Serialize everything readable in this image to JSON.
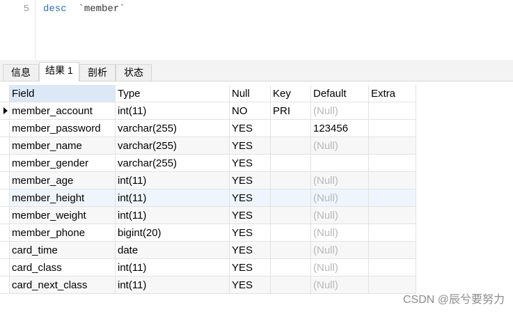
{
  "editor": {
    "line_number": "5",
    "keyword": "desc",
    "identifier": "`member`"
  },
  "tabs": [
    {
      "label": "信息",
      "active": false
    },
    {
      "label": "结果 1",
      "active": true
    },
    {
      "label": "剖析",
      "active": false
    },
    {
      "label": "状态",
      "active": false
    }
  ],
  "table": {
    "columns": [
      "Field",
      "Type",
      "Null",
      "Key",
      "Default",
      "Extra"
    ],
    "rows": [
      {
        "field": "member_account",
        "type": "int(11)",
        "null": "NO",
        "key": "PRI",
        "default": "(Null)",
        "extra": ""
      },
      {
        "field": "member_password",
        "type": "varchar(255)",
        "null": "YES",
        "key": "",
        "default": "123456",
        "extra": ""
      },
      {
        "field": "member_name",
        "type": "varchar(255)",
        "null": "YES",
        "key": "",
        "default": "(Null)",
        "extra": ""
      },
      {
        "field": "member_gender",
        "type": "varchar(255)",
        "null": "YES",
        "key": "",
        "default": "",
        "extra": ""
      },
      {
        "field": "member_age",
        "type": "int(11)",
        "null": "YES",
        "key": "",
        "default": "(Null)",
        "extra": ""
      },
      {
        "field": "member_height",
        "type": "int(11)",
        "null": "YES",
        "key": "",
        "default": "(Null)",
        "extra": ""
      },
      {
        "field": "member_weight",
        "type": "int(11)",
        "null": "YES",
        "key": "",
        "default": "(Null)",
        "extra": ""
      },
      {
        "field": "member_phone",
        "type": "bigint(20)",
        "null": "YES",
        "key": "",
        "default": "(Null)",
        "extra": ""
      },
      {
        "field": "card_time",
        "type": "date",
        "null": "YES",
        "key": "",
        "default": "(Null)",
        "extra": ""
      },
      {
        "field": "card_class",
        "type": "int(11)",
        "null": "YES",
        "key": "",
        "default": "(Null)",
        "extra": ""
      },
      {
        "field": "card_next_class",
        "type": "int(11)",
        "null": "YES",
        "key": "",
        "default": "(Null)",
        "extra": ""
      }
    ]
  },
  "watermark": "CSDN @辰兮要努力",
  "colors": {
    "keyword": "#2f6fba",
    "null_text": "#b8b8b8",
    "selected_header": "#dce8f6"
  }
}
